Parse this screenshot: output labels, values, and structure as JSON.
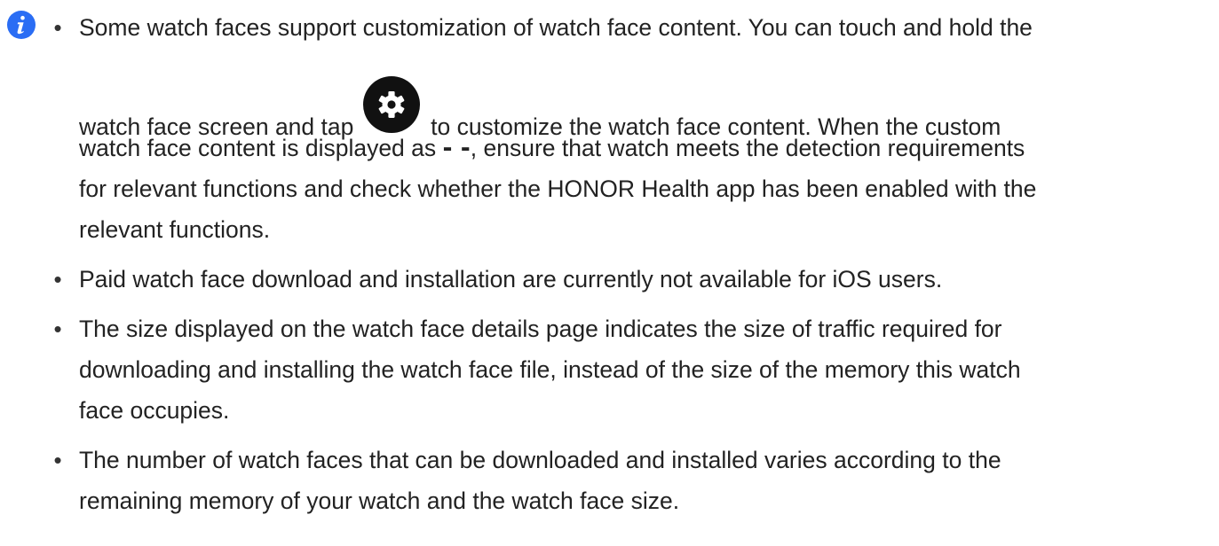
{
  "icons": {
    "info": "info-icon",
    "settings": "gear-icon"
  },
  "colors": {
    "info_icon": "#2a6df4",
    "gear_background": "#111111",
    "text": "#222222"
  },
  "bullets": [
    {
      "marker": "•",
      "lines": [
        "Some watch faces support customization of watch face content. You can touch and hold the",
        {
          "before": "watch face screen and tap",
          "after": "to customize the watch face content. When the custom"
        },
        {
          "before": "watch face content is displayed as ",
          "bold": "- -",
          "after": ", ensure that watch meets the detection requirements"
        },
        "for relevant functions and check whether the HONOR Health app has been enabled with the",
        "relevant functions."
      ]
    },
    {
      "marker": "•",
      "lines": [
        "Paid watch face download and installation are currently not available for iOS users."
      ]
    },
    {
      "marker": "•",
      "lines": [
        "The size displayed on the watch face details page indicates the size of traffic required for",
        "downloading and installing the watch face file, instead of the size of the memory this watch",
        "face occupies."
      ]
    },
    {
      "marker": "•",
      "lines": [
        "The number of watch faces that can be downloaded and installed varies according to the",
        "remaining memory of your watch and the watch face size."
      ]
    }
  ]
}
